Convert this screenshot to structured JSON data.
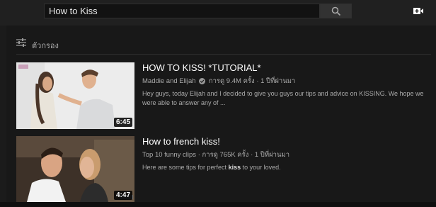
{
  "search": {
    "query": "How to Kiss"
  },
  "icons": {
    "search": "search-icon",
    "upload": "video-upload-icon",
    "filter": "filter-sliders-icon",
    "verified": "verified-check-icon"
  },
  "filter": {
    "label": "ตัวกรอง"
  },
  "results": [
    {
      "title": "HOW TO KISS! *TUTORIAL*",
      "channel": "Maddie and Elijah",
      "views": "การดู 9.4M ครั้ง",
      "age": "1 ปีที่ผ่านมา",
      "description": "Hey guys, today Elijah and I decided to give you guys our tips and advice on KISSING. We hope we were able to answer any of ...",
      "duration": "6:45"
    },
    {
      "title": "How to french kiss!",
      "channel": "Top 10 funny clips",
      "views": "การดู 765K ครั้ง",
      "age": "1 ปีที่ผ่านมา",
      "description_before": "Here are some tips for perfect ",
      "description_bold": "kiss",
      "description_after": " to your loved.",
      "duration": "4:47"
    }
  ],
  "separator": "·",
  "colors": {
    "background": "#181818",
    "topbar": "#202020",
    "text_secondary": "#aaaaaa"
  }
}
